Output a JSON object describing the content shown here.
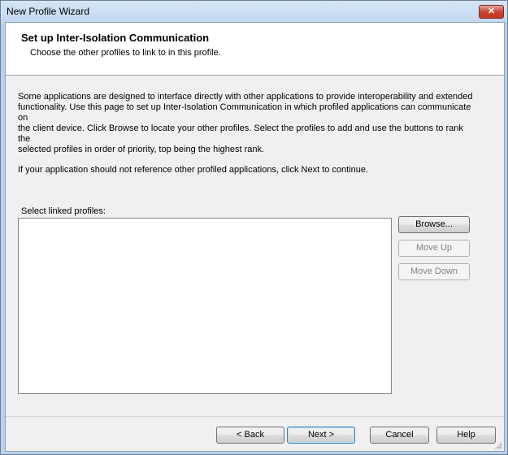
{
  "window": {
    "title": "New Profile Wizard",
    "close_glyph": "✕"
  },
  "header": {
    "title": "Set up Inter-Isolation Communication",
    "subtitle": "Choose the other profiles to link to in this profile."
  },
  "body": {
    "description_lines": [
      "Some applications are designed to interface directly with other applications to provide interoperability and extended",
      "functionality. Use this page to set up Inter-Isolation Communication in which profiled applications can communicate on",
      "the client device. Click Browse to locate your other profiles. Select the profiles to add and use the buttons to rank the",
      "selected profiles in order of priority, top being the highest rank."
    ],
    "hint": "If your application should not reference other profiled applications, click Next to continue.",
    "list_label": "Select linked profiles:"
  },
  "side_buttons": {
    "browse": "Browse...",
    "move_up": "Move Up",
    "move_down": "Move Down"
  },
  "footer_buttons": {
    "back": "< Back",
    "next": "Next >",
    "cancel": "Cancel",
    "help": "Help"
  }
}
